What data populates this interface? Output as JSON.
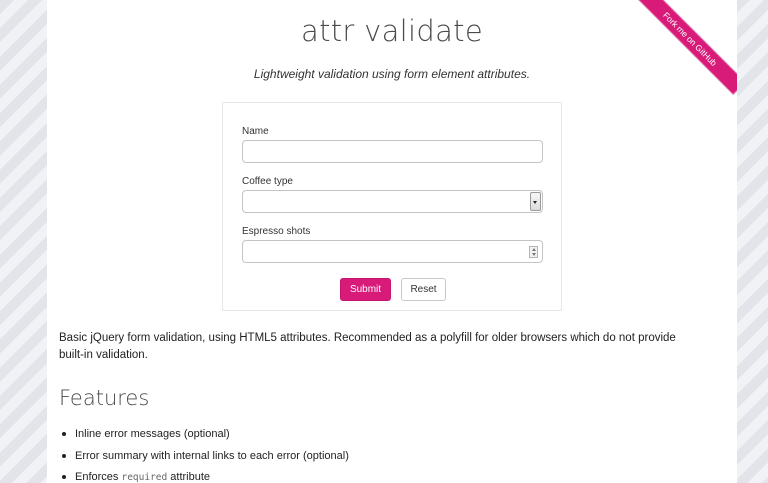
{
  "header": {
    "title": "attr validate",
    "subtitle": "Lightweight validation using form element attributes."
  },
  "ribbon": {
    "label": "Fork me on GitHub",
    "color": "#d81b78"
  },
  "form": {
    "name_label": "Name",
    "name_value": "",
    "coffee_label": "Coffee type",
    "coffee_selected": "",
    "espresso_label": "Espresso shots",
    "espresso_value": "",
    "submit_label": "Submit",
    "reset_label": "Reset",
    "accent_color": "#d81b78"
  },
  "description": "Basic jQuery form validation, using HTML5 attributes. Recommended as a polyfill for older browsers which do not provide built-in validation.",
  "features": {
    "heading": "Features",
    "items": [
      {
        "text": "Inline error messages (optional)"
      },
      {
        "text": "Error summary with internal links to each error (optional)"
      },
      {
        "prefix": "Enforces ",
        "code": "required",
        "suffix": " attribute"
      }
    ]
  }
}
